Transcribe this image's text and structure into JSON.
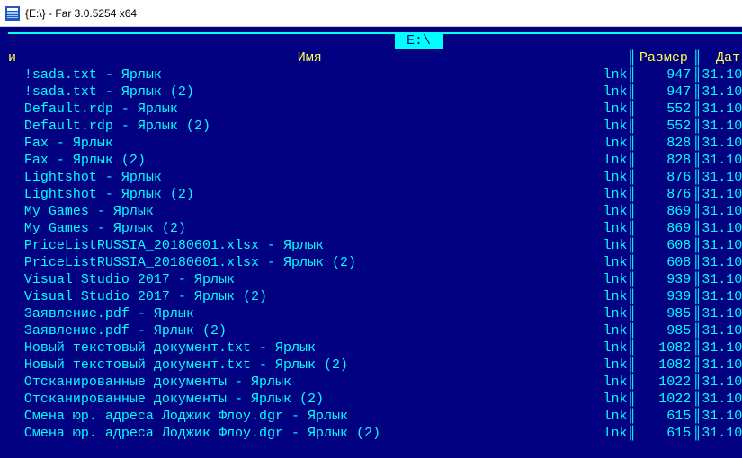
{
  "window": {
    "title": "{E:\\} - Far 3.0.5254 x64"
  },
  "panel": {
    "path": " E:\\ ",
    "columns": {
      "name": "Имя",
      "size": "Размер",
      "date": "Дат",
      "sort_indicator": "и"
    },
    "column_separator": "║",
    "border_char": "═",
    "corner_tl": "╔",
    "corner_hdr_down": "╤"
  },
  "files": [
    {
      "name": "!sada.txt - Ярлык",
      "ext": "lnk",
      "size": "947",
      "date": "31.10"
    },
    {
      "name": "!sada.txt - Ярлык (2)",
      "ext": "lnk",
      "size": "947",
      "date": "31.10"
    },
    {
      "name": "Default.rdp - Ярлык",
      "ext": "lnk",
      "size": "552",
      "date": "31.10"
    },
    {
      "name": "Default.rdp - Ярлык (2)",
      "ext": "lnk",
      "size": "552",
      "date": "31.10"
    },
    {
      "name": "Fax - Ярлык",
      "ext": "lnk",
      "size": "828",
      "date": "31.10"
    },
    {
      "name": "Fax - Ярлык (2)",
      "ext": "lnk",
      "size": "828",
      "date": "31.10"
    },
    {
      "name": "Lightshot - Ярлык",
      "ext": "lnk",
      "size": "876",
      "date": "31.10"
    },
    {
      "name": "Lightshot - Ярлык (2)",
      "ext": "lnk",
      "size": "876",
      "date": "31.10"
    },
    {
      "name": "My Games - Ярлык",
      "ext": "lnk",
      "size": "869",
      "date": "31.10"
    },
    {
      "name": "My Games - Ярлык (2)",
      "ext": "lnk",
      "size": "869",
      "date": "31.10"
    },
    {
      "name": "PriceListRUSSIA_20180601.xlsx - Ярлык",
      "ext": "lnk",
      "size": "608",
      "date": "31.10"
    },
    {
      "name": "PriceListRUSSIA_20180601.xlsx - Ярлык (2)",
      "ext": "lnk",
      "size": "608",
      "date": "31.10"
    },
    {
      "name": "Visual Studio 2017 - Ярлык",
      "ext": "lnk",
      "size": "939",
      "date": "31.10"
    },
    {
      "name": "Visual Studio 2017 - Ярлык (2)",
      "ext": "lnk",
      "size": "939",
      "date": "31.10"
    },
    {
      "name": "Заявление.pdf - Ярлык",
      "ext": "lnk",
      "size": "985",
      "date": "31.10"
    },
    {
      "name": "Заявление.pdf - Ярлык (2)",
      "ext": "lnk",
      "size": "985",
      "date": "31.10"
    },
    {
      "name": "Новый текстовый документ.txt - Ярлык",
      "ext": "lnk",
      "size": "1082",
      "date": "31.10"
    },
    {
      "name": "Новый текстовый документ.txt - Ярлык (2)",
      "ext": "lnk",
      "size": "1082",
      "date": "31.10"
    },
    {
      "name": "Отсканированные документы - Ярлык",
      "ext": "lnk",
      "size": "1022",
      "date": "31.10"
    },
    {
      "name": "Отсканированные документы - Ярлык (2)",
      "ext": "lnk",
      "size": "1022",
      "date": "31.10"
    },
    {
      "name": "Смена юр. адреса Лоджик Флоу.dgr - Ярлык",
      "ext": "lnk",
      "size": "615",
      "date": "31.10"
    },
    {
      "name": "Смена юр. адреса Лоджик Флоу.dgr - Ярлык (2)",
      "ext": "lnk",
      "size": "615",
      "date": "31.10"
    }
  ],
  "colors": {
    "bg": "#000080",
    "fg": "#00ffff",
    "header": "#ffff55"
  }
}
